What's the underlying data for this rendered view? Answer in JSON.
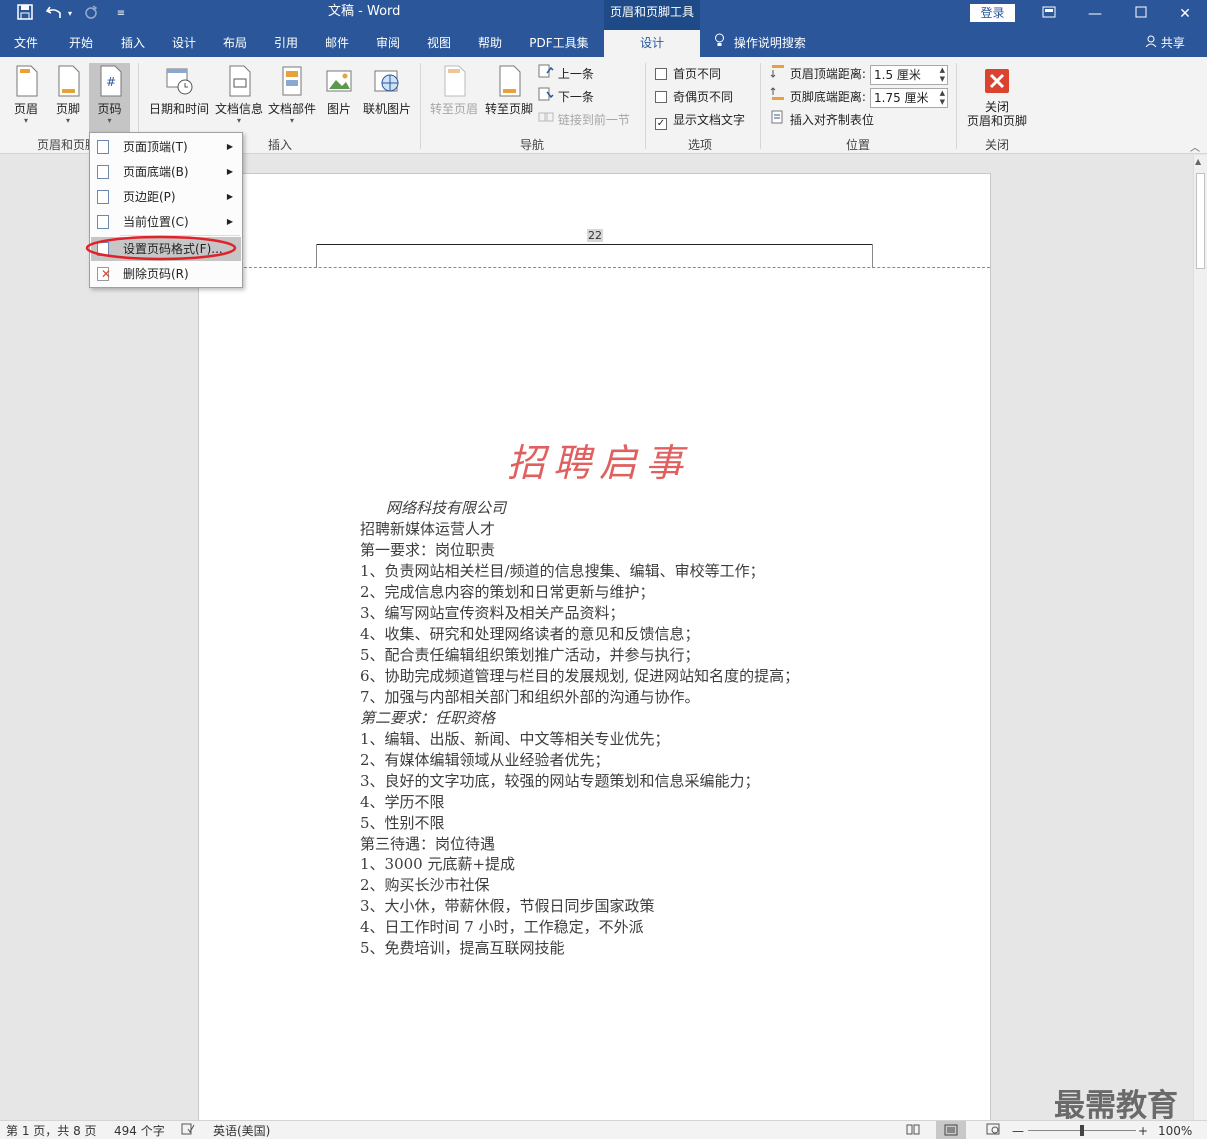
{
  "titlebar": {
    "doc_name": "文稿",
    "separator": "-",
    "app": "Word",
    "context_tool": "页眉和页脚工具",
    "login": "登录"
  },
  "quick_access": {
    "save": "save-icon",
    "undo": "undo-icon",
    "redo": "redo-icon",
    "customize": "customize-icon"
  },
  "window_controls": {
    "ribbon_display": "ribbon-display-icon",
    "minimize": "minimize-icon",
    "maximize": "maximize-icon",
    "close": "close-icon"
  },
  "tabs": [
    "文件",
    "开始",
    "插入",
    "设计",
    "布局",
    "引用",
    "邮件",
    "审阅",
    "视图",
    "帮助",
    "PDF工具集",
    "设计"
  ],
  "tell_me": "操作说明搜索",
  "share": "共享",
  "ribbon": {
    "header_footer": {
      "header": "页眉",
      "footer": "页脚",
      "page_number": "页码",
      "group": "页眉和页脚"
    },
    "insert": {
      "date_time": "日期和时间",
      "doc_info": "文档信息",
      "quick_parts": "文档部件",
      "picture": "图片",
      "online_picture": "联机图片",
      "group": "插入"
    },
    "navigation": {
      "goto_header": "转至页眉",
      "goto_footer": "转至页脚",
      "previous": "上一条",
      "next": "下一条",
      "link_previous": "链接到前一节",
      "group": "导航"
    },
    "options": {
      "diff_first": "首页不同",
      "diff_odd_even": "奇偶页不同",
      "show_doc_text": "显示文档文字",
      "group": "选项"
    },
    "position": {
      "header_top_label": "页眉顶端距离:",
      "header_top_value": "1.5 厘米",
      "footer_bottom_label": "页脚底端距离:",
      "footer_bottom_value": "1.75 厘米",
      "align_tab": "插入对齐制表位",
      "group": "位置"
    },
    "close": {
      "label1": "关闭",
      "label2": "页眉和页脚",
      "group": "关闭"
    }
  },
  "menu": {
    "items": [
      "页面顶端(T)",
      "页面底端(B)",
      "页边距(P)",
      "当前位置(C)",
      "设置页码格式(F)...",
      "删除页码(R)"
    ]
  },
  "page": {
    "header_number": "22",
    "title": "招聘启事",
    "lines": [
      "网络科技有限公司",
      "招聘新媒体运营人才",
      "第一要求：岗位职责",
      "1、负责网站相关栏目/频道的信息搜集、编辑、审校等工作；",
      "2、完成信息内容的策划和日常更新与维护；",
      "3、编写网站宣传资料及相关产品资料；",
      "4、收集、研究和处理网络读者的意见和反馈信息；",
      "5、配合责任编辑组织策划推广活动，并参与执行；",
      "6、协助完成频道管理与栏目的发展规划, 促进网站知名度的提高；",
      "7、加强与内部相关部门和组织外部的沟通与协作。",
      "第二要求：任职资格",
      "1、编辑、出版、新闻、中文等相关专业优先；",
      "2、有媒体编辑领域从业经验者优先；",
      "3、良好的文字功底，较强的网站专题策划和信息采编能力；",
      "4、学历不限",
      "5、性别不限",
      "第三待遇：岗位待遇",
      "1、3000 元底薪+提成",
      "2、购买长沙市社保",
      "3、大小休，带薪休假，节假日同步国家政策",
      "4、日工作时间 7 小时，工作稳定，不外派",
      "5、免费培训，提高互联网技能"
    ]
  },
  "status": {
    "page": "第 1 页，共 8 页",
    "words": "494 个字",
    "language": "英语(美国)",
    "zoom": "100%"
  },
  "watermark": "最需教育",
  "colors": {
    "ribbon_blue": "#2b579a",
    "title_red": "#e06060",
    "close_red": "#d9432f",
    "highlight_oval": "#e0232a"
  }
}
